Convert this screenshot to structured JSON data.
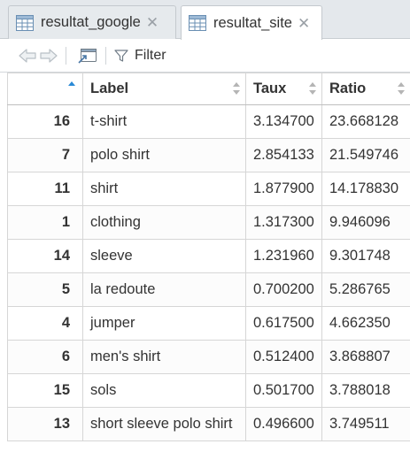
{
  "tabs": [
    {
      "label": "resultat_google",
      "active": false
    },
    {
      "label": "resultat_site",
      "active": true
    }
  ],
  "toolbar": {
    "filter_label": "Filter"
  },
  "table": {
    "columns": [
      "",
      "Label",
      "Taux",
      "Ratio"
    ],
    "sorted_column": 0,
    "sort_direction": "ascending",
    "rows": [
      {
        "idx": "16",
        "label": "t-shirt",
        "taux": "3.134700",
        "ratio": "23.668128"
      },
      {
        "idx": "7",
        "label": "polo shirt",
        "taux": "2.854133",
        "ratio": "21.549746"
      },
      {
        "idx": "11",
        "label": "shirt",
        "taux": "1.877900",
        "ratio": "14.178830"
      },
      {
        "idx": "1",
        "label": "clothing",
        "taux": "1.317300",
        "ratio": "9.946096"
      },
      {
        "idx": "14",
        "label": "sleeve",
        "taux": "1.231960",
        "ratio": "9.301748"
      },
      {
        "idx": "5",
        "label": "la redoute",
        "taux": "0.700200",
        "ratio": "5.286765"
      },
      {
        "idx": "4",
        "label": "jumper",
        "taux": "0.617500",
        "ratio": "4.662350"
      },
      {
        "idx": "6",
        "label": "men's shirt",
        "taux": "0.512400",
        "ratio": "3.868807"
      },
      {
        "idx": "15",
        "label": "sols",
        "taux": "0.501700",
        "ratio": "3.788018"
      },
      {
        "idx": "13",
        "label": "short sleeve polo shirt",
        "taux": "0.496600",
        "ratio": "3.749511"
      }
    ]
  },
  "colors": {
    "sort_active": "#2a8ad6",
    "sort_inactive": "#b5b5b5"
  }
}
